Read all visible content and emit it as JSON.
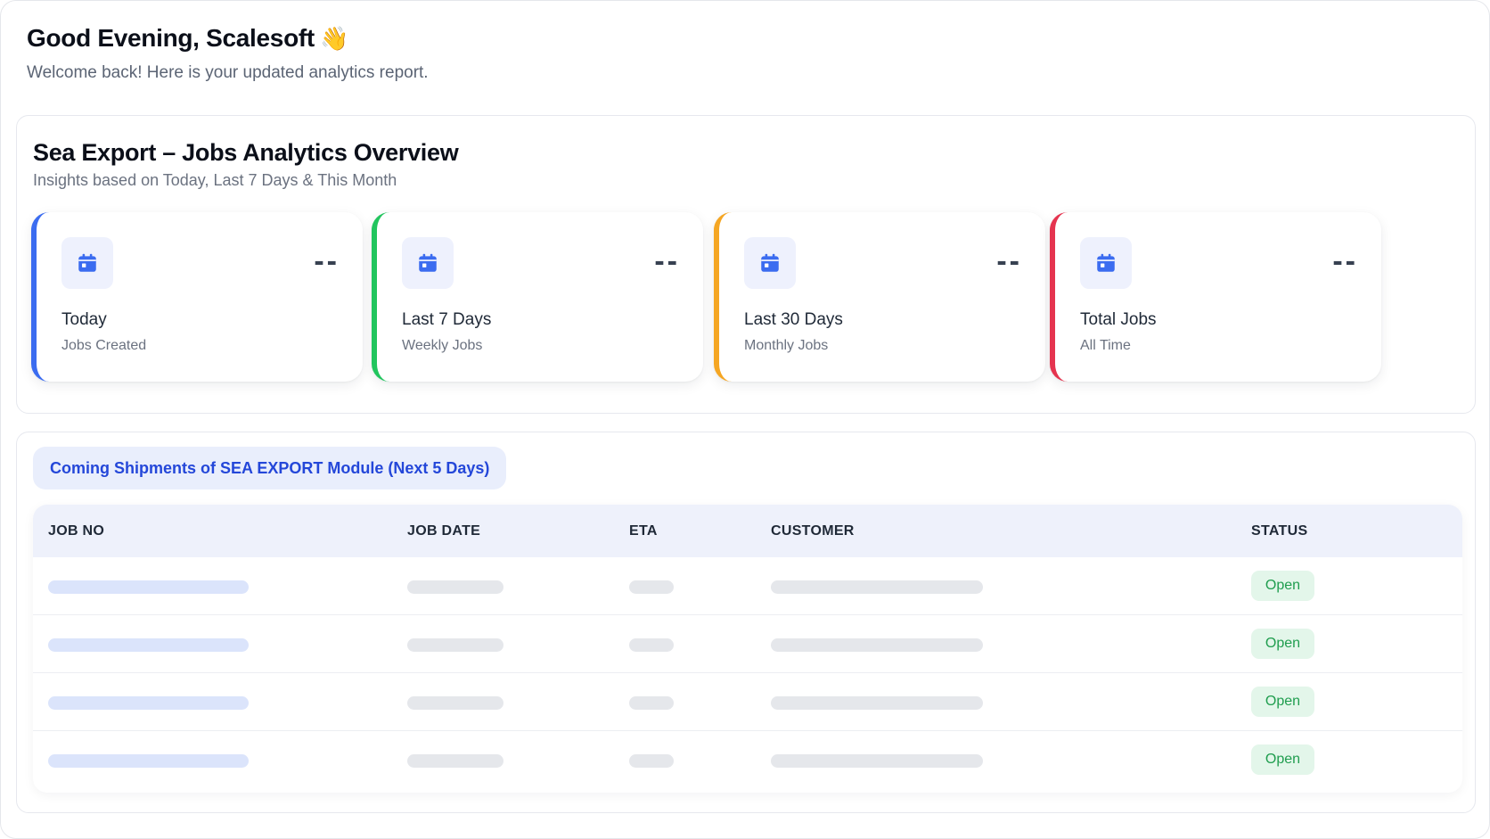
{
  "greeting": {
    "title": "Good Evening, Scalesoft",
    "emoji": "👋",
    "subtitle": "Welcome back! Here is your updated analytics report."
  },
  "overview": {
    "title": "Sea Export – Jobs Analytics Overview",
    "subtitle": "Insights based on Today, Last 7 Days & This Month",
    "cards": [
      {
        "label": "Today",
        "description": "Jobs Created",
        "value": "--",
        "accent": "#3b6cf0",
        "icon": "calendar-icon"
      },
      {
        "label": "Last 7 Days",
        "description": "Weekly Jobs",
        "value": "--",
        "accent": "#22c55e",
        "icon": "calendar-icon"
      },
      {
        "label": "Last 30 Days",
        "description": "Monthly Jobs",
        "value": "--",
        "accent": "#f5a623",
        "icon": "calendar-icon"
      },
      {
        "label": "Total Jobs",
        "description": "All Time",
        "value": "--",
        "accent": "#e5344f",
        "icon": "calendar-icon"
      }
    ]
  },
  "shipments": {
    "title": "Coming Shipments of SEA EXPORT Module (Next 5 Days)",
    "columns": [
      "JOB NO",
      "JOB DATE",
      "ETA",
      "CUSTOMER",
      "STATUS"
    ],
    "rows": [
      {
        "status": "Open"
      },
      {
        "status": "Open"
      },
      {
        "status": "Open"
      },
      {
        "status": "Open"
      }
    ]
  },
  "colors": {
    "primary": "#2447d9",
    "status_open_text": "#1f9d4e",
    "status_open_bg": "#e3f6ea"
  }
}
